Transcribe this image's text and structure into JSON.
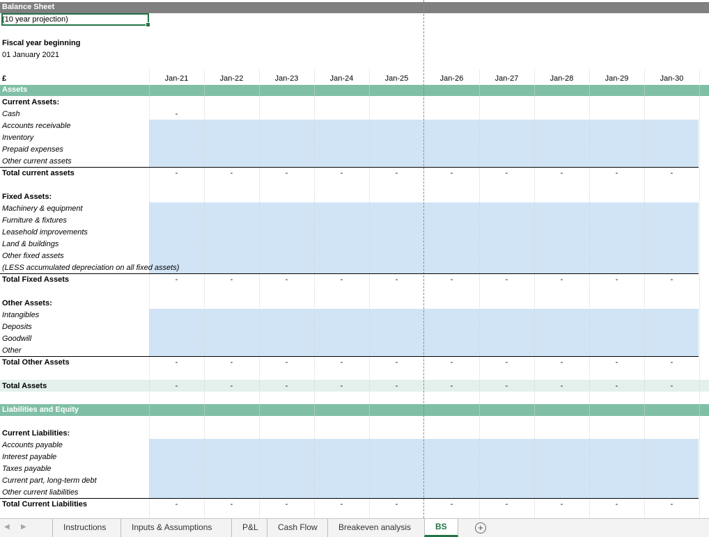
{
  "header": {
    "title": "Balance Sheet",
    "subtitle": "(10 year projection)",
    "fiscal_label": "Fiscal year beginning",
    "fiscal_date": "01 January 2021",
    "currency": "£"
  },
  "columns": [
    "Jan-21",
    "Jan-22",
    "Jan-23",
    "Jan-24",
    "Jan-25",
    "Jan-26",
    "Jan-27",
    "Jan-28",
    "Jan-29",
    "Jan-30"
  ],
  "dash": "-",
  "assets": {
    "section_title": "Assets",
    "current": {
      "heading": "Current Assets:",
      "items": [
        "Cash",
        "Accounts receivable",
        "Inventory",
        "Prepaid expenses",
        "Other current assets"
      ],
      "cash_value": "-",
      "total_label": "Total current assets"
    },
    "fixed": {
      "heading": "Fixed Assets:",
      "items": [
        "Machinery & equipment",
        "Furniture & fixtures",
        "Leasehold improvements",
        "Land & buildings",
        "Other fixed assets",
        "(LESS accumulated depreciation on all fixed assets)"
      ],
      "total_label": "Total Fixed Assets"
    },
    "other": {
      "heading": "Other Assets:",
      "items": [
        "Intangibles",
        "Deposits",
        "Goodwill",
        "Other"
      ],
      "total_label": "Total Other Assets"
    },
    "total_label": "Total Assets"
  },
  "liabilities": {
    "section_title": "Liabilities and Equity",
    "current": {
      "heading": "Current Liabilities:",
      "items": [
        "Accounts payable",
        "Interest payable",
        "Taxes payable",
        "Current part, long-term debt",
        "Other current liabilities"
      ],
      "total_label": "Total Current Liabilities"
    }
  },
  "tabs": [
    "Instructions",
    "Inputs & Assumptions",
    "P&L",
    "Cash Flow",
    "Breakeven analysis",
    "BS"
  ],
  "active_tab": "BS",
  "add_sheet_glyph": "+",
  "nav_prev_glyph": "◀",
  "nav_next_glyph": "▶",
  "colors": {
    "accent": "#217346",
    "section_band": "#7fbfa6",
    "title_band": "#808080",
    "input_fill": "#d0e4f5",
    "total_assets_band": "#e3f0ec"
  }
}
